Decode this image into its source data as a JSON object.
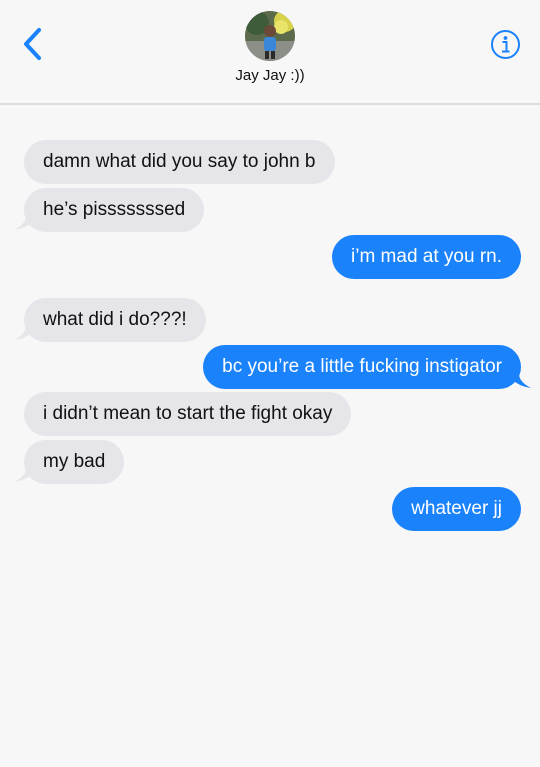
{
  "header": {
    "contact_name": "Jay Jay :))",
    "back_icon": "chevron-left-icon",
    "info_icon": "info-circle-icon",
    "accent_color": "#1a82fb"
  },
  "messages": [
    {
      "direction": "incoming",
      "text": "damn what did you say to john b",
      "tail": false
    },
    {
      "direction": "incoming",
      "text": "he’s pisssssssed",
      "tail": true
    },
    {
      "direction": "outgoing",
      "text": "i’m mad at you rn.",
      "tail": false
    },
    {
      "direction": "incoming",
      "text": "what did i do???!",
      "tail": true
    },
    {
      "direction": "outgoing",
      "text": "bc you’re a little fucking instigator",
      "tail": true
    },
    {
      "direction": "incoming",
      "text": "i didn’t mean to start the fight okay",
      "tail": false
    },
    {
      "direction": "incoming",
      "text": "my bad",
      "tail": true
    },
    {
      "direction": "outgoing",
      "text": "whatever jj",
      "tail": false
    }
  ],
  "colors": {
    "incoming_bubble": "#e5e5ea",
    "outgoing_bubble": "#1a82fb",
    "background": "#f7f7f8"
  }
}
